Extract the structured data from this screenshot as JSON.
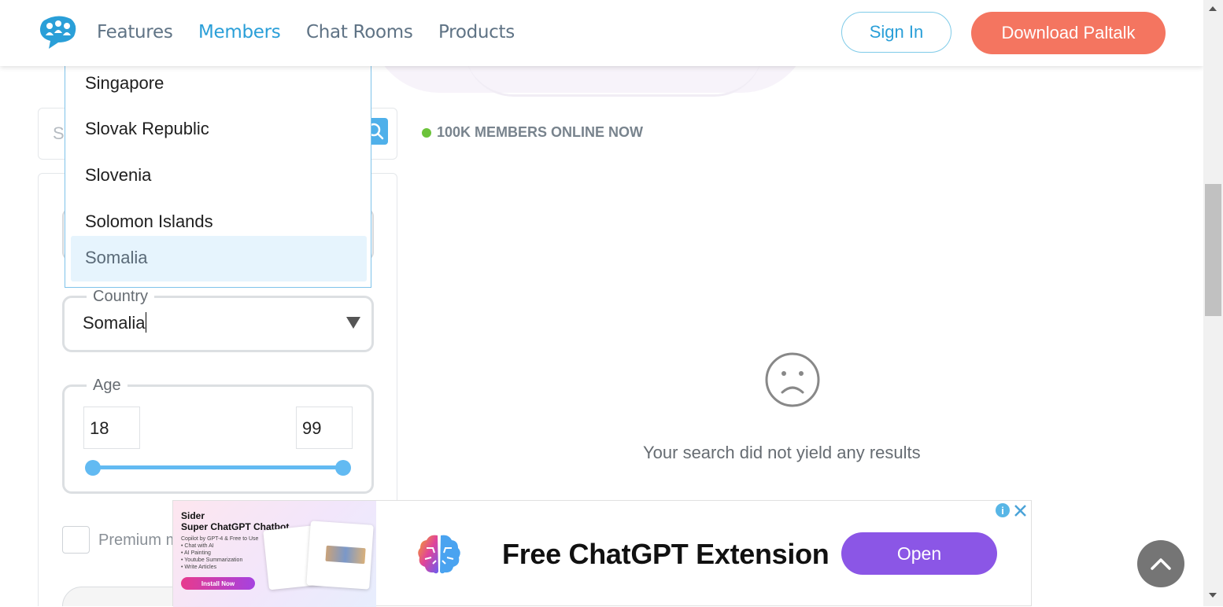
{
  "header": {
    "nav": [
      "Features",
      "Members",
      "Chat Rooms",
      "Products"
    ],
    "active_nav": "Members",
    "sign_in": "Sign In",
    "download": "Download Paltalk"
  },
  "search": {
    "placeholder": "S"
  },
  "country_dropdown": {
    "options": [
      "Singapore",
      "Slovak Republic",
      "Slovenia",
      "Solomon Islands",
      "Somalia"
    ],
    "highlighted": "Somalia"
  },
  "filters": {
    "country_label": "Country",
    "country_value": "Somalia",
    "age_label": "Age",
    "age_min": "18",
    "age_max": "99",
    "premium_label": "Premium m"
  },
  "main": {
    "online_status": "100K MEMBERS ONLINE NOW",
    "no_results": "Your search did not yield any results"
  },
  "ad": {
    "brand": "Sider",
    "tagline": "Super ChatGPT Chatbot",
    "sub_lines": [
      "Copilot by GPT-4 & Free to Use",
      "• Chat with AI",
      "• AI Painting",
      "• Youtube Summarization",
      "• Write Articles"
    ],
    "install": "Install Now",
    "headline": "Free ChatGPT Extension",
    "cta": "Open"
  },
  "colors": {
    "accent": "#2a9fd8",
    "download_btn": "#f47560",
    "online_dot": "#6cc33a",
    "slider": "#62baf2",
    "ad_cta": "#8b56e6"
  }
}
